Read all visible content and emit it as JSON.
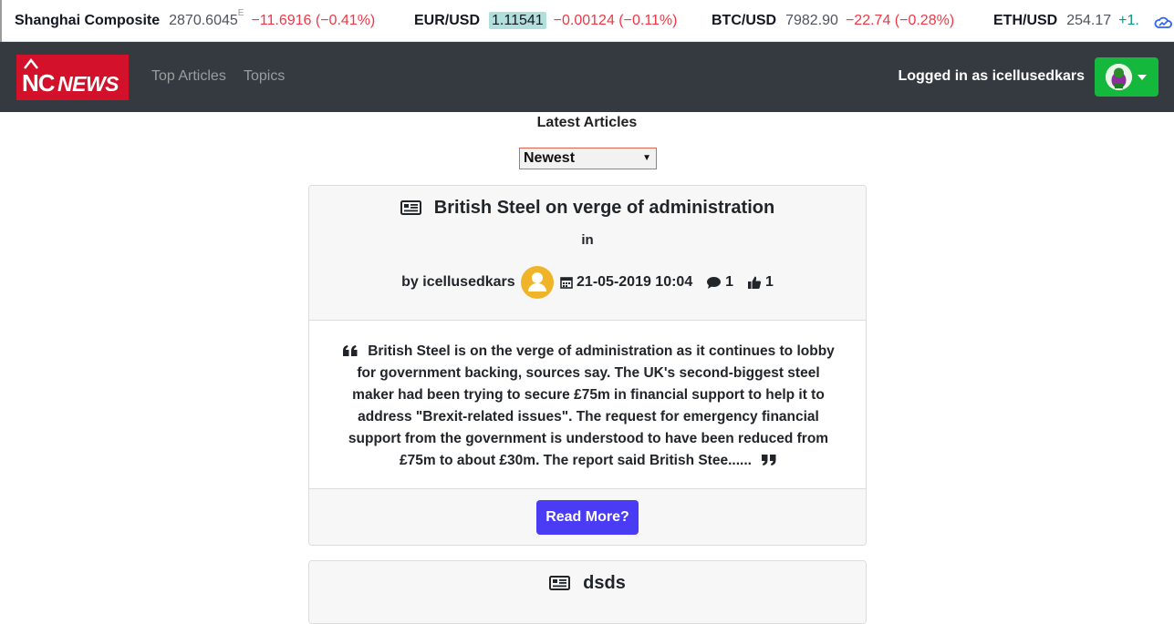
{
  "ticker": {
    "items": [
      {
        "symbol": "Shanghai Composite",
        "price": "2870.6045",
        "flag": "E",
        "change": "−11.6916 (−0.41%)",
        "direction": "down"
      },
      {
        "symbol": "EUR/USD",
        "price": "1.11541",
        "change": "−0.00124 (−0.11%)",
        "direction": "down"
      },
      {
        "symbol": "BTC/USD",
        "price": "7982.90",
        "change": "−22.74 (−0.28%)",
        "direction": "down"
      },
      {
        "symbol": "ETH/USD",
        "price": "254.17",
        "change": "+1.",
        "direction": "up"
      }
    ]
  },
  "nav": {
    "brand_nc": "NC",
    "brand_news": "NEWS",
    "links": [
      "Top Articles",
      "Topics"
    ],
    "login_text": "Logged in as icellusedkars"
  },
  "main": {
    "heading": "Latest Articles",
    "sort_selected": "Newest"
  },
  "articles": [
    {
      "title": "British Steel on verge of administration",
      "topic": "in",
      "author_prefix": "by icellusedkars",
      "date": "21-05-2019 10:04",
      "comments": "1",
      "votes": "1",
      "summary": "British Steel is on the verge of administration as it continues to lobby for government backing, sources say. The UK's second-biggest steel maker had been trying to secure £75m in financial support to help it to address \"Brexit-related issues\". The request for emergency financial support from the government is understood to have been reduced from £75m to about £30m. The report said British Stee......",
      "read_more": "Read More?"
    },
    {
      "title": "dsds"
    }
  ],
  "colors": {
    "navbar": "#343a40",
    "brand_red": "#d4112b",
    "user_button_green": "#13b83d",
    "read_more_button": "#4a3cf5",
    "avatar_yellow": "#f0b429",
    "negative": "#f23645",
    "positive": "#089981"
  }
}
